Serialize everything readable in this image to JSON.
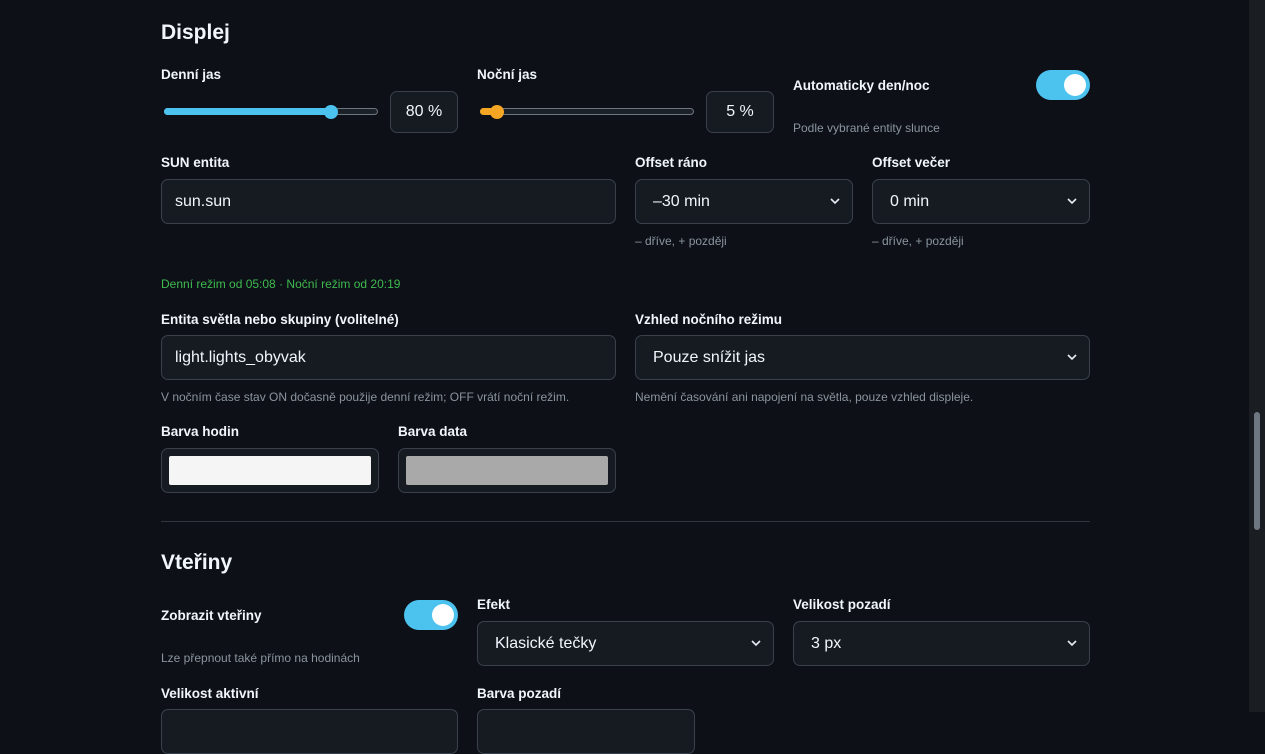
{
  "colors": {
    "accent": "#4cc2ef",
    "night_accent": "#f5a623",
    "green_text": "#3fb950",
    "clock_color": "#f5f5f5",
    "date_color": "#a9a9a9"
  },
  "display": {
    "title": "Displej",
    "day_brightness": {
      "label": "Denní jas",
      "value": "80 %",
      "fraction": 0.8
    },
    "night_brightness": {
      "label": "Noční jas",
      "value": "5 %",
      "fraction": 0.05
    },
    "auto_day_night": {
      "label": "Automaticky den/noc",
      "hint": "Podle vybrané entity slunce",
      "on": true
    },
    "sun_entity": {
      "label": "SUN entita",
      "value": "sun.sun"
    },
    "offset_morning": {
      "label": "Offset ráno",
      "value": "–30 min",
      "hint": "– dříve, + později"
    },
    "offset_evening": {
      "label": "Offset večer",
      "value": "0 min",
      "hint": "– dříve, + později"
    },
    "schedule_info": "Denní režim od 05:08 · Noční režim od 20:19",
    "light_entity": {
      "label": "Entita světla nebo skupiny (volitelné)",
      "value": "light.lights_obyvak",
      "hint": "V nočním čase stav ON dočasně použije denní režim; OFF vrátí noční režim."
    },
    "night_look": {
      "label": "Vzhled nočního režimu",
      "value": "Pouze snížit jas",
      "hint": "Nemění časování ani napojení na světla, pouze vzhled displeje."
    },
    "clock_color": {
      "label": "Barva hodin"
    },
    "date_color": {
      "label": "Barva data"
    }
  },
  "seconds": {
    "title": "Vteřiny",
    "show_seconds": {
      "label": "Zobrazit vteřiny",
      "hint": "Lze přepnout také přímo na hodinách",
      "on": true
    },
    "effect": {
      "label": "Efekt",
      "value": "Klasické tečky"
    },
    "background_size": {
      "label": "Velikost pozadí",
      "value": "3 px"
    },
    "active_size": {
      "label": "Velikost aktivní"
    },
    "background_color": {
      "label": "Barva pozadí"
    }
  },
  "icons": {
    "select_arrow": "chevron-down-icon"
  }
}
